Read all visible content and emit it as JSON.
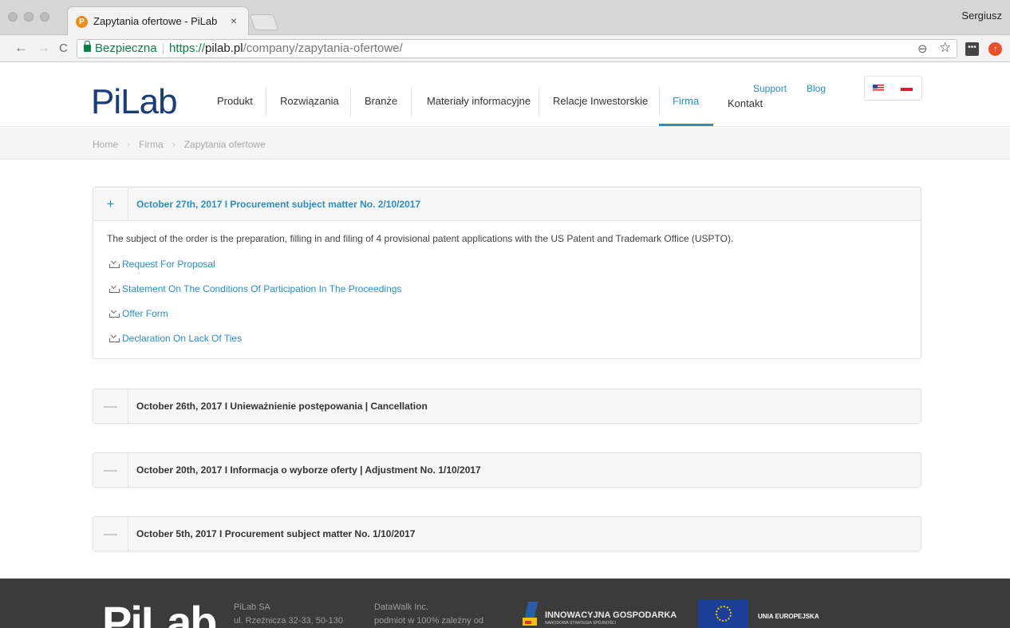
{
  "browser": {
    "tab_title": "Zapytania ofertowe - PiLab",
    "tab_favicon_letter": "P",
    "tab_close": "×",
    "profile_name": "Sergiusz",
    "secure_label": "Bezpieczna",
    "url_prefix": "https://",
    "url_domain": "pilab.pl",
    "url_path": "/company/zapytania-ofertowe/",
    "nav_back": "←",
    "nav_forward": "→",
    "nav_reload": "C",
    "zoom_glyph": "⊖",
    "star_glyph": "☆",
    "ext1_glyph": "•••",
    "ext2_glyph": "↑"
  },
  "header": {
    "logo": "PiLab",
    "menu": [
      "Produkt",
      "Rozwiązania",
      "Branże",
      "Materiały informacyjne",
      "Relacje Inwestorskie",
      "Firma",
      "Kontakt"
    ],
    "active_menu": "Firma",
    "top_links": [
      "Support",
      "Blog"
    ],
    "languages": [
      "us-flag",
      "pl-flag"
    ]
  },
  "breadcrumb": {
    "items": [
      "Home",
      "Firma",
      "Zapytania ofertowe"
    ],
    "separator": "›"
  },
  "accordion": [
    {
      "toggle": "+",
      "title": "October 27th, 2017 I Procurement subject matter No. 2/10/2017",
      "open": true,
      "description": "The subject of the order is the preparation, filling in and filing of 4 provisional patent applications with the US Patent and Trademark Office (USPTO).",
      "links": [
        "Request For Proposal",
        "Statement On The Conditions Of Participation In The Proceedings",
        "Offer Form",
        "Declaration On Lack Of Ties"
      ]
    },
    {
      "toggle": "—",
      "title": "October 26th, 2017 I Unieważnienie postępowania | Cancellation",
      "open": false
    },
    {
      "toggle": "—",
      "title": "October 20th, 2017 I Informacja o wyborze oferty | Adjustment No. 1/10/2017",
      "open": false
    },
    {
      "toggle": "—",
      "title": "October 5th, 2017 I Procurement subject matter No. 1/10/2017",
      "open": false
    }
  ],
  "footer": {
    "logo": "PiLab",
    "col1": [
      "PiLab SA",
      "ul. Rzeźnicza 32-33, 50-130"
    ],
    "col2": [
      "DataWalk Inc.",
      "podmiot w 100% zależny od"
    ],
    "ig_title": "INNOWACYJNA GOSPODARKA",
    "ig_subtitle": "NARODOWA STRATEGIA SPÓJNOŚCI",
    "eu_label": "UNIA EUROPEJSKA"
  },
  "colors": {
    "accent": "#2a8fc7",
    "logo_blue": "#1a3d7a",
    "footer_bg": "#3b3b3b",
    "secure_green": "#0b8043"
  }
}
